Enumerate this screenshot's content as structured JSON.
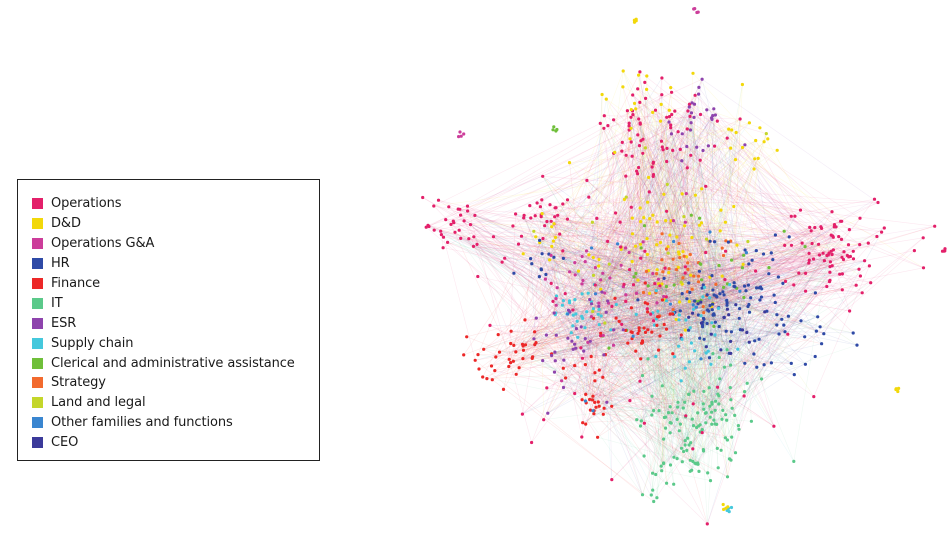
{
  "legend": {
    "title": "",
    "items": [
      {
        "label": "Operations",
        "color": "#e3206a"
      },
      {
        "label": "D&D",
        "color": "#f2d80a"
      },
      {
        "label": "Operations G&A",
        "color": "#cc3d9a"
      },
      {
        "label": "HR",
        "color": "#2f4aa6"
      },
      {
        "label": "Finance",
        "color": "#ec2828"
      },
      {
        "label": "IT",
        "color": "#5bc98a"
      },
      {
        "label": "ESR",
        "color": "#8e44ad"
      },
      {
        "label": "Supply chain",
        "color": "#45c8dc"
      },
      {
        "label": "Clerical and administrative assistance",
        "color": "#6fbf3a"
      },
      {
        "label": "Strategy",
        "color": "#f26a2e"
      },
      {
        "label": "Land and legal",
        "color": "#c4d62a"
      },
      {
        "label": "Other families and functions",
        "color": "#3a86d0"
      },
      {
        "label": "CEO",
        "color": "#3b3a9a"
      }
    ]
  },
  "network": {
    "description": "Organizational network graph of employees colored by job family",
    "categories": [
      "Operations",
      "D&D",
      "Operations G&A",
      "HR",
      "Finance",
      "IT",
      "ESR",
      "Supply chain",
      "Clerical and administrative assistance",
      "Strategy",
      "Land and legal",
      "Other families and functions",
      "CEO"
    ]
  }
}
